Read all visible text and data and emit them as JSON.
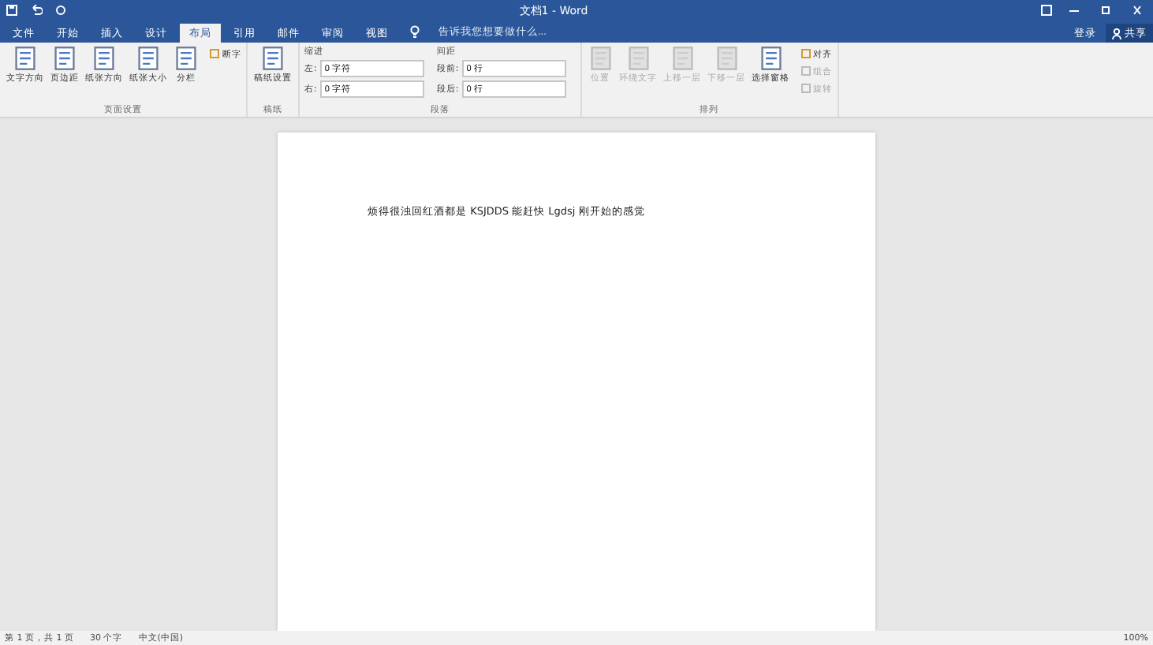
{
  "window": {
    "title": "文档1 - Word"
  },
  "tabs": [
    {
      "label": "文件",
      "selected": false
    },
    {
      "label": "开始",
      "selected": false
    },
    {
      "label": "插入",
      "selected": false
    },
    {
      "label": "设计",
      "selected": false
    },
    {
      "label": "布局",
      "selected": true
    },
    {
      "label": "引用",
      "selected": false
    },
    {
      "label": "邮件",
      "selected": false
    },
    {
      "label": "审阅",
      "selected": false
    },
    {
      "label": "视图",
      "selected": false
    }
  ],
  "tell_me": {
    "placeholder": "告诉我您想要做什么..."
  },
  "account": {
    "sign_in": "登录",
    "share": "共享"
  },
  "ribbon": [
    {
      "title": "页面设置",
      "large": [
        {
          "label": "文字方向",
          "disabled": false
        },
        {
          "label": "页边距",
          "disabled": false
        },
        {
          "label": "纸张方向",
          "disabled": false
        },
        {
          "label": "纸张大小",
          "disabled": false
        },
        {
          "label": "分栏",
          "disabled": false
        }
      ],
      "small": [
        {
          "label": "断字",
          "disabled": false
        }
      ]
    },
    {
      "title": "稿纸",
      "large": [
        {
          "label": "稿纸设置",
          "disabled": false
        }
      ]
    },
    {
      "title": "段落",
      "kind": "paragraph",
      "indent": {
        "heading": "缩进",
        "left_label": "左:",
        "left_value": "0 字符",
        "right_label": "右:",
        "right_value": "0 字符"
      },
      "spacing": {
        "heading": "间距",
        "before_label": "段前:",
        "before_value": "0 行",
        "after_label": "段后:",
        "after_value": "0 行"
      }
    },
    {
      "title": "排列",
      "large": [
        {
          "label": "位置",
          "disabled": true
        },
        {
          "label": "环绕文字",
          "disabled": true
        },
        {
          "label": "上移一层",
          "disabled": true
        },
        {
          "label": "下移一层",
          "disabled": true
        },
        {
          "label": "选择窗格",
          "disabled": false
        }
      ],
      "small": [
        {
          "label": "对齐",
          "disabled": false
        },
        {
          "label": "组合",
          "disabled": true
        },
        {
          "label": "旋转",
          "disabled": true
        }
      ]
    }
  ],
  "document": {
    "text": "烦得很浊回红酒都是 KSJDDS 能赶快 Lgdsj 刚开始的感觉"
  },
  "status_bar": {
    "page": "第 1 页，共 1 页",
    "words": "30 个字",
    "language": "中文(中国)",
    "zoom": "100%"
  }
}
